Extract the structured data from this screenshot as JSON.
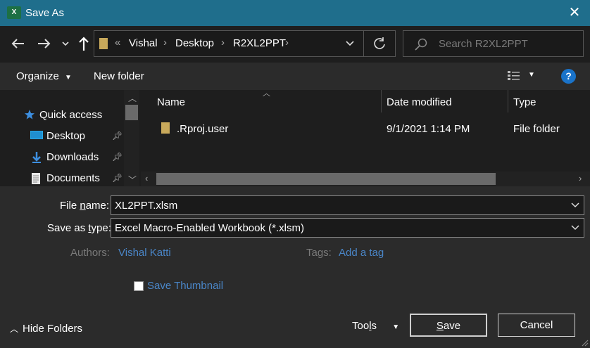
{
  "window": {
    "title": "Save As",
    "app_icon_text": "X"
  },
  "nav": {
    "breadcrumb_overflow": "«",
    "breadcrumbs": [
      "Vishal",
      "Desktop",
      "R2XL2PPT"
    ],
    "search_placeholder": "Search R2XL2PPT"
  },
  "toolbar": {
    "organize_label": "Organize",
    "new_folder_label": "New folder"
  },
  "sidebar": {
    "items": [
      {
        "label": "Quick access",
        "icon": "star-icon"
      },
      {
        "label": "Desktop",
        "icon": "desktop-icon",
        "pinned": true
      },
      {
        "label": "Downloads",
        "icon": "download-arrow-icon",
        "pinned": true
      },
      {
        "label": "Documents",
        "icon": "document-icon",
        "pinned": true
      }
    ]
  },
  "file_list": {
    "columns": [
      "Name",
      "Date modified",
      "Type"
    ],
    "rows": [
      {
        "name": ".Rproj.user",
        "date_modified": "9/1/2021 1:14 PM",
        "type": "File folder"
      }
    ]
  },
  "form": {
    "file_name_label_pre": "File ",
    "file_name_label_accel": "n",
    "file_name_label_post": "ame:",
    "file_name_value": "XL2PPT.xlsm",
    "save_type_label_pre": "Save as ",
    "save_type_label_accel": "t",
    "save_type_label_post": "ype:",
    "save_type_value": "Excel Macro-Enabled Workbook (*.xlsm)",
    "authors_label": "Authors:",
    "authors_value": "Vishal Katti",
    "tags_label": "Tags:",
    "tags_value": "Add a tag",
    "save_thumbnail_label": "Save Thumbnail"
  },
  "footer": {
    "hide_folders_label": "Hide Folders",
    "tools_label_pre": "Too",
    "tools_label_accel": "l",
    "tools_label_post": "s",
    "save_label_pre": "",
    "save_label_accel": "S",
    "save_label_post": "ave",
    "cancel_label": "Cancel"
  },
  "colors": {
    "titlebar": "#1f6e8c",
    "link": "#4a86c8",
    "help": "#1a73c9",
    "star": "#3d8fe0",
    "folder": "#c8a95b"
  }
}
